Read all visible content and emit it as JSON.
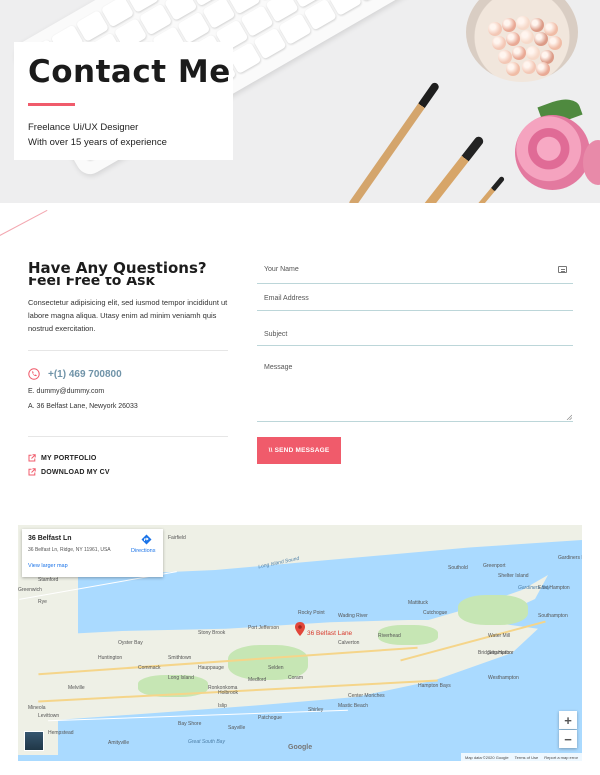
{
  "hero": {
    "title": "Contact Me",
    "subtitle_line1": "Freelance Ui/UX Designer",
    "subtitle_line2": "With over 15 years of experience"
  },
  "questions": {
    "title": "Have Any Questions?",
    "subtitle": "Feel Free to Ask",
    "paragraph": "Consectetur adipisicing elit, sed iusmod tempor incididunt ut labore magna aliqua. Utasy enim ad minim veniamh quis nostrud exercitation."
  },
  "contact": {
    "phone": "+(1) 469 700800",
    "email": "E. dummy@dummy.com",
    "address": "A. 36 Belfast Lane, Newyork 26033"
  },
  "links": {
    "portfolio": "MY PORTFOLIO",
    "cv": "DOWNLOAD MY CV"
  },
  "form": {
    "name_placeholder": "Your Name",
    "email_placeholder": "Email Address",
    "subject_placeholder": "Subject",
    "message_placeholder": "Message",
    "send_label": "\\\\ SEND MESSAGE"
  },
  "map": {
    "card_title": "36 Belfast Ln",
    "card_address": "36 Belfast Ln, Ridge, NY 11961, USA",
    "directions": "Directions",
    "larger_map": "View larger map",
    "pin_label": "36 Belfast Lane",
    "google": "Google",
    "attr_data": "Map data ©2020 Google",
    "attr_terms": "Terms of Use",
    "attr_report": "Report a map error",
    "zoom_in": "+",
    "zoom_out": "−",
    "towns": [
      {
        "name": "Fairfield"
      },
      {
        "name": "Bridgeport"
      },
      {
        "name": "Stamford"
      },
      {
        "name": "Greenwich"
      },
      {
        "name": "Rye"
      },
      {
        "name": "Huntington"
      },
      {
        "name": "Melville"
      },
      {
        "name": "Long Island"
      },
      {
        "name": "Ronkonkoma"
      },
      {
        "name": "Medford"
      },
      {
        "name": "Riverhead"
      },
      {
        "name": "Southold"
      },
      {
        "name": "Greenport"
      },
      {
        "name": "Shelter Island"
      },
      {
        "name": "Mattituck"
      },
      {
        "name": "Cutchogue"
      },
      {
        "name": "Bridgehampton"
      },
      {
        "name": "Water Mill"
      },
      {
        "name": "Southampton"
      },
      {
        "name": "Hampton Bays"
      },
      {
        "name": "Westhampton"
      },
      {
        "name": "Calverton"
      },
      {
        "name": "Shirley"
      },
      {
        "name": "Mastic Beach"
      },
      {
        "name": "Center Moriches"
      },
      {
        "name": "Patchogue"
      },
      {
        "name": "Bay Shore"
      },
      {
        "name": "Islip"
      },
      {
        "name": "Levittown"
      },
      {
        "name": "Hempstead"
      },
      {
        "name": "Amityville"
      },
      {
        "name": "Stony Brook"
      },
      {
        "name": "Port Jefferson"
      },
      {
        "name": "Rocky Point"
      },
      {
        "name": "Wading River"
      },
      {
        "name": "Smithtown"
      },
      {
        "name": "Commack"
      },
      {
        "name": "Mineola"
      },
      {
        "name": "Gardiners Island"
      },
      {
        "name": "Sag Harbor"
      },
      {
        "name": "East Hampton"
      },
      {
        "name": "Sayville"
      },
      {
        "name": "Oyster Bay"
      },
      {
        "name": "Hauppauge"
      },
      {
        "name": "Coram"
      },
      {
        "name": "Selden"
      },
      {
        "name": "Holbrook"
      }
    ],
    "water": [
      {
        "name": "Long Island Sound"
      },
      {
        "name": "Great South Bay"
      },
      {
        "name": "Gardiners Bay"
      }
    ]
  },
  "colors": {
    "accent": "#f05b6b",
    "phone_blue": "#6f93a8",
    "field_line": "#bcd6d9"
  }
}
